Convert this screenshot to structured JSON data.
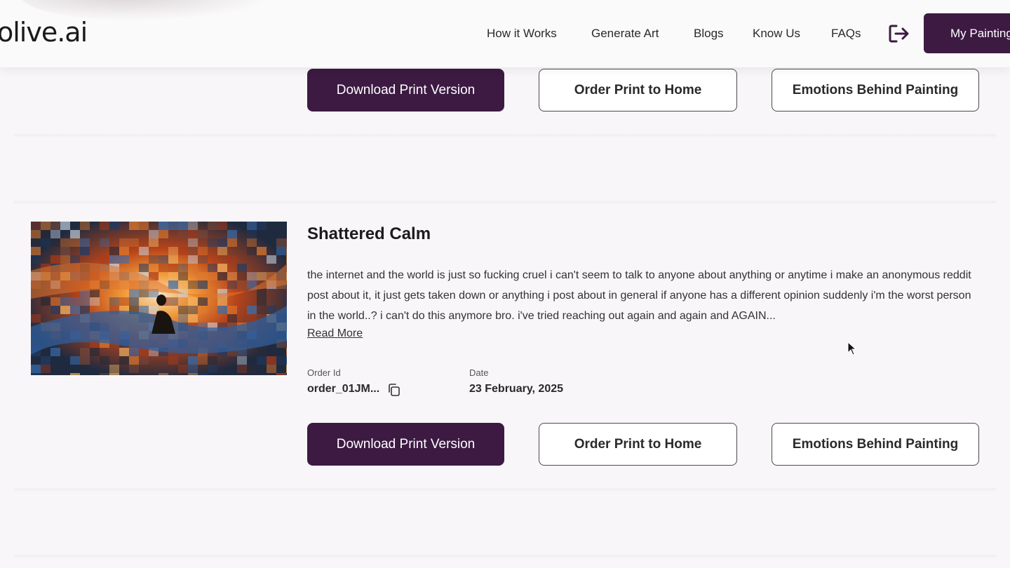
{
  "header": {
    "logo_text": "olive.ai",
    "nav": [
      "How it Works",
      "Generate Art",
      "Blogs",
      "Know Us",
      "FAQs"
    ],
    "logout_icon": "logout-icon",
    "my_paintings_label": "My Paintings"
  },
  "top_actions": {
    "download_label": "Download Print Version",
    "order_label": "Order Print to Home",
    "emotions_label": "Emotions Behind Painting"
  },
  "painting": {
    "title": "Shattered Calm",
    "description": "the internet and the world is just so fucking cruel i can't seem to talk to anyone about anything or anytime i make an anonymous reddit post about it, it just gets taken down or anything i post about in general if anyone has a different opinion suddenly i'm the worst person in the world..? i can't do this anymore bro. i've tried reaching out again and again and AGAIN...",
    "read_more_label": "Read More",
    "order_id_label": "Order Id",
    "order_id_value": "order_01JM...",
    "date_label": "Date",
    "date_value": "23 February, 2025",
    "copy_icon": "copy-icon",
    "actions": {
      "download_label": "Download Print Version",
      "order_label": "Order Print to Home",
      "emotions_label": "Emotions Behind Painting"
    }
  },
  "colors": {
    "brand": "#3c1a42",
    "background": "#f8f6f8",
    "outline": "#4a4a4a"
  }
}
